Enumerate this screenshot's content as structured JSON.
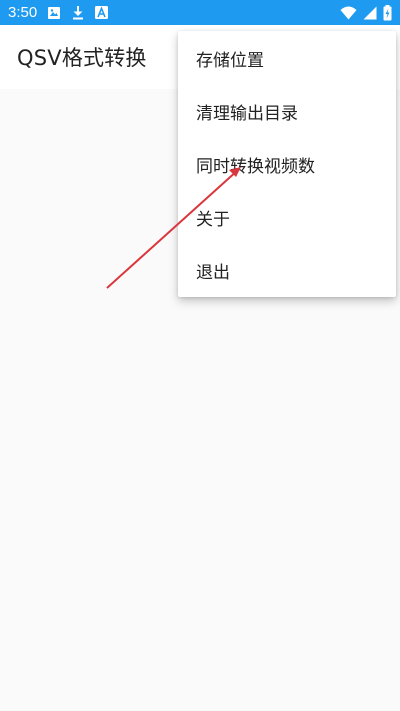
{
  "status_bar": {
    "time": "3:50",
    "color": "#1e9bf0",
    "left_icons": [
      "image-icon",
      "download-icon",
      "a-badge-icon"
    ],
    "right_icons": [
      "wifi-icon",
      "signal-icon",
      "battery-charging-icon"
    ]
  },
  "app_bar": {
    "title": "QSV格式转换"
  },
  "menu": {
    "items": [
      {
        "label": "存储位置"
      },
      {
        "label": "清理输出目录"
      },
      {
        "label": "同时转换视频数"
      },
      {
        "label": "关于"
      },
      {
        "label": "退出"
      }
    ]
  },
  "annotation": {
    "color": "#d9363e"
  }
}
